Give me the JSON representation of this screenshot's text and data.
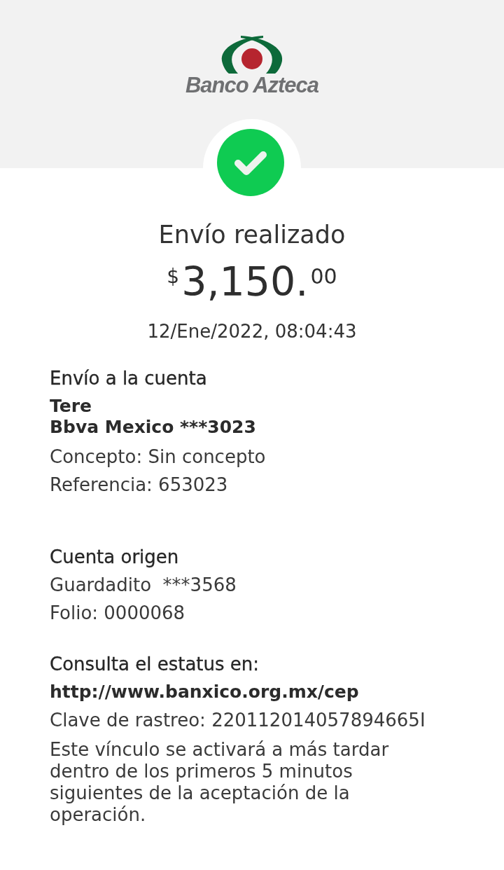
{
  "header": {
    "logo_text": "Banco Azteca"
  },
  "status": {
    "title": "Envío realizado"
  },
  "amount": {
    "currency": "$",
    "integer": "3,150.",
    "decimals": "00"
  },
  "datetime": "12/Ene/2022, 08:04:43",
  "recipient": {
    "heading": "Envío a la cuenta",
    "name": "Tere",
    "account": "Bbva Mexico ***3023",
    "details": [
      "Concepto: Sin concepto",
      "Referencia: 653023"
    ]
  },
  "origin": {
    "heading": "Cuenta origen",
    "details": [
      "Guardadito  ***3568",
      "Folio: 0000068"
    ]
  },
  "tracking": {
    "heading": "Consulta el estatus en:",
    "link": "http://www.banxico.org.mx/cep",
    "tracking_key": "Clave de rastreo: 220112014057894665I",
    "note": "Este vínculo se activará a más tardar dentro de los primeros 5 minutos siguientes de la aceptación de la operación."
  }
}
